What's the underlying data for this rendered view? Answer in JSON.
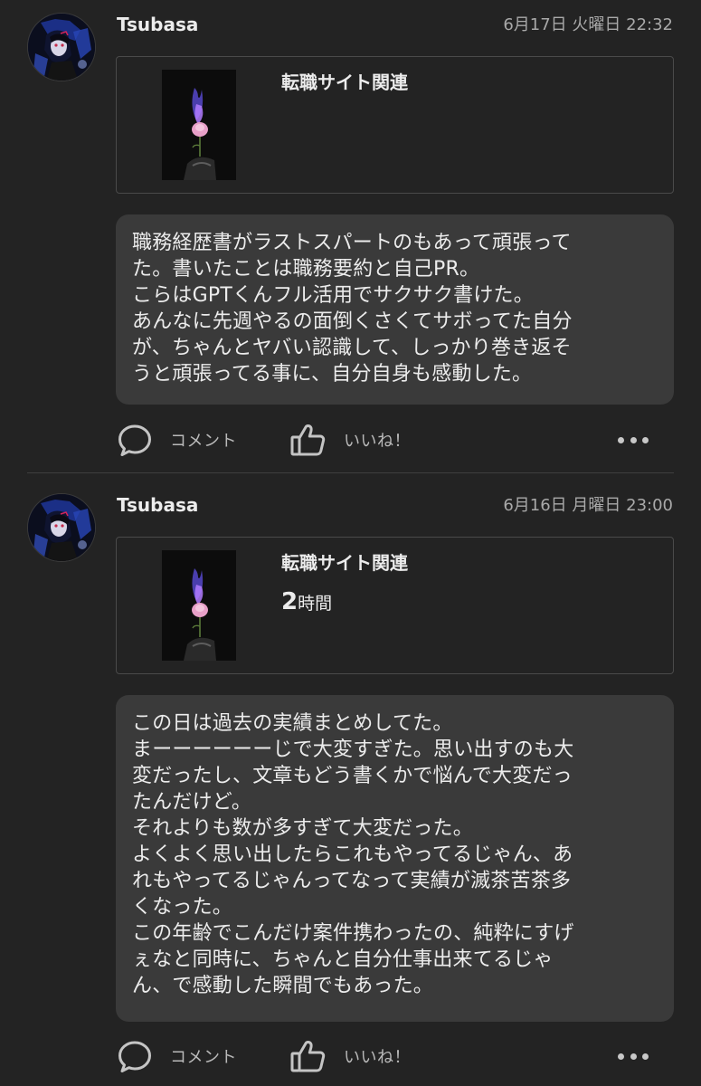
{
  "posts": [
    {
      "author": "Tsubasa",
      "timestamp": "6月17日 火曜日 22:32",
      "card": {
        "title": "転職サイト関連",
        "duration_number": "",
        "duration_unit": ""
      },
      "body_lines": [
        "職務経歴書がラストスパートのもあって頑張って",
        "た。書いたことは職務要約と自己PR。",
        "こらはGPTくんフル活用でサクサク書けた。",
        "あんなに先週やるの面倒くさくてサボってた自分",
        "が、ちゃんとヤバい認識して、しっかり巻き返そ",
        "うと頑張ってる事に、自分自身も感動した。"
      ],
      "comment_label": "コメント",
      "like_label": "いいね！"
    },
    {
      "author": "Tsubasa",
      "timestamp": "6月16日 月曜日 23:00",
      "card": {
        "title": "転職サイト関連",
        "duration_number": "2",
        "duration_unit": "時間"
      },
      "body_lines": [
        "この日は過去の実績まとめしてた。",
        "まーーーーーーじで大変すぎた。思い出すのも大",
        "変だったし、文章もどう書くかで悩んで大変だっ",
        "たんだけど。",
        "それよりも数が多すぎて大変だった。",
        "よくよく思い出したらこれもやってるじゃん、あ",
        "れもやってるじゃんってなって実績が滅茶苦茶多",
        "くなった。",
        "この年齢でこんだけ案件携わったの、純粋にすげ",
        "ぇなと同時に、ちゃんと自分仕事出来てるじゃ",
        "ん、で感動した瞬間でもあった。"
      ],
      "comment_label": "コメント",
      "like_label": "いいね！"
    }
  ],
  "icons": {
    "comment": "speech-bubble-icon",
    "like": "thumbs-up-icon",
    "more": "more-dots-icon"
  },
  "colors": {
    "background": "#232323",
    "bubble": "#3a3a3a",
    "card_border": "#4a4a4a",
    "text": "#ececec",
    "muted": "#a9a9a9"
  }
}
